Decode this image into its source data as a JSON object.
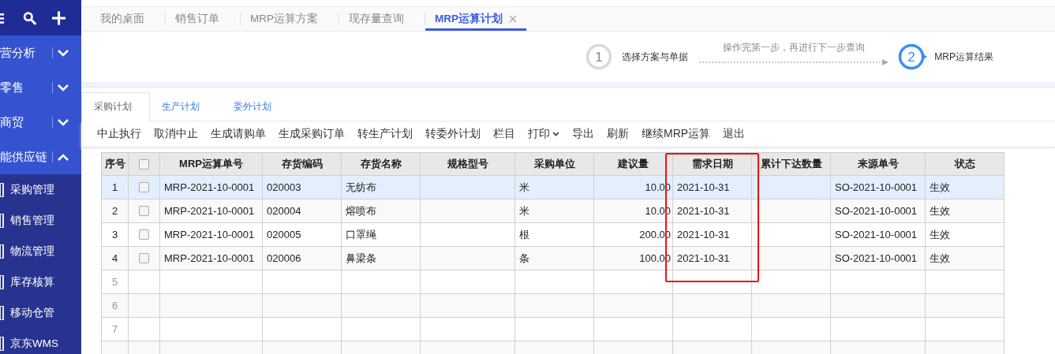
{
  "sidebar": {
    "groups": [
      {
        "label": "营分析",
        "expanded": false
      },
      {
        "label": "零售",
        "expanded": false
      },
      {
        "label": "商贸",
        "expanded": false
      },
      {
        "label": "能供应链",
        "expanded": true,
        "children": [
          {
            "label": "采购管理"
          },
          {
            "label": "销售管理"
          },
          {
            "label": "物流管理"
          },
          {
            "label": "库存核算"
          },
          {
            "label": "移动仓管"
          },
          {
            "label": "京东WMS"
          }
        ]
      }
    ]
  },
  "tabs": [
    {
      "label": "我的桌面",
      "selected": false,
      "closable": false
    },
    {
      "label": "销售订单",
      "selected": false,
      "closable": false
    },
    {
      "label": "MRP运算方案",
      "selected": false,
      "closable": false
    },
    {
      "label": "现存量查询",
      "selected": false,
      "closable": false
    },
    {
      "label": "MRP运算计划",
      "selected": true,
      "closable": true
    }
  ],
  "steps": [
    {
      "number": "1",
      "label": "选择方案与单据",
      "selected": false
    },
    {
      "number": "2",
      "label": "MRP运算结果",
      "selected": true
    }
  ],
  "step_hint": "操作完第一步，再进行下一步查询",
  "plan_tabs": [
    {
      "label": "采购计划",
      "selected": true
    },
    {
      "label": "生产计划",
      "selected": false
    },
    {
      "label": "委外计划",
      "selected": false
    }
  ],
  "toolbar": [
    {
      "label": "中止执行",
      "has_menu": false
    },
    {
      "label": "取消中止",
      "has_menu": false
    },
    {
      "label": "生成请购单",
      "has_menu": false
    },
    {
      "label": "生成采购订单",
      "has_menu": false
    },
    {
      "label": "转生产计划",
      "has_menu": false
    },
    {
      "label": "转委外计划",
      "has_menu": false
    },
    {
      "label": "栏目",
      "has_menu": false
    },
    {
      "label": "打印",
      "has_menu": true
    },
    {
      "label": "导出",
      "has_menu": false
    },
    {
      "label": "刷新",
      "has_menu": false
    },
    {
      "label": "继续MRP运算",
      "has_menu": false
    },
    {
      "label": "退出",
      "has_menu": false
    }
  ],
  "table": {
    "header_checked": false,
    "columns": [
      {
        "label": "序号",
        "highlighted": false
      },
      {
        "kind": "check",
        "highlighted": false
      },
      {
        "label": "MRP运算单号",
        "highlighted": false
      },
      {
        "label": "存货编码",
        "highlighted": false
      },
      {
        "label": "存货名称",
        "highlighted": false
      },
      {
        "label": "规格型号",
        "highlighted": false
      },
      {
        "label": "采购单位",
        "highlighted": false
      },
      {
        "label": "建议量",
        "highlighted": false
      },
      {
        "label": "需求日期",
        "highlighted": true
      },
      {
        "label": "累计下达数量",
        "highlighted": false
      },
      {
        "label": "来源单号",
        "highlighted": false
      },
      {
        "label": "状态",
        "highlighted": false
      }
    ],
    "rows": [
      {
        "index": "1",
        "selected": true,
        "checked": false,
        "order_no": "MRP-2021-10-0001",
        "code": "020003",
        "name": "无纺布",
        "unit": "米",
        "quantity": "10.00",
        "date": "2021-10-31",
        "source": "SO-2021-10-0001",
        "status": "生效"
      },
      {
        "index": "2",
        "selected": false,
        "checked": false,
        "order_no": "MRP-2021-10-0001",
        "code": "020004",
        "name": "熔喷布",
        "unit": "米",
        "quantity": "10.00",
        "date": "2021-10-31",
        "source": "SO-2021-10-0001",
        "status": "生效"
      },
      {
        "index": "3",
        "selected": false,
        "checked": false,
        "order_no": "MRP-2021-10-0001",
        "code": "020005",
        "name": "口罩绳",
        "unit": "根",
        "quantity": "200.00",
        "date": "2021-10-31",
        "source": "SO-2021-10-0001",
        "status": "生效"
      },
      {
        "index": "4",
        "selected": false,
        "checked": false,
        "order_no": "MRP-2021-10-0001",
        "code": "020006",
        "name": "鼻梁条",
        "unit": "条",
        "quantity": "100.00",
        "date": "2021-10-31",
        "source": "SO-2021-10-0001",
        "status": "生效"
      }
    ],
    "empty_rows": [
      "5",
      "6",
      "7"
    ]
  }
}
